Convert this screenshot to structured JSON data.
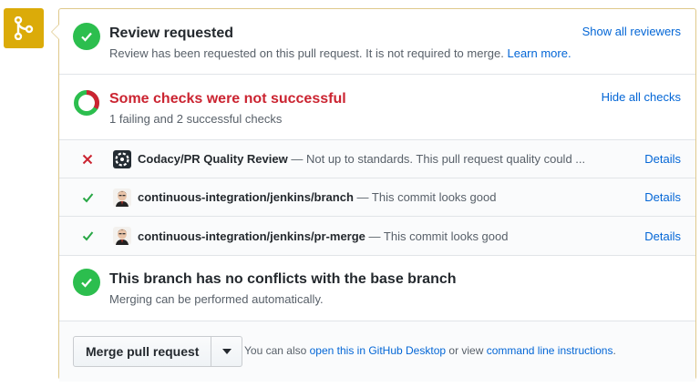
{
  "review": {
    "title": "Review requested",
    "subtitle": "Review has been requested on this pull request. It is not required to merge.",
    "learn_more": "Learn more.",
    "show_reviewers": "Show all reviewers"
  },
  "checks": {
    "title": "Some checks were not successful",
    "subtitle": "1 failing and 2 successful checks",
    "hide_all": "Hide all checks",
    "summary": {
      "failing": 1,
      "successful": 2
    },
    "items": [
      {
        "status": "failure",
        "context": "Codacy/PR Quality Review",
        "description": "— Not up to standards. This pull request quality could ...",
        "details": "Details",
        "avatar_icon": "codacy-logo-icon"
      },
      {
        "status": "success",
        "context": "continuous-integration/jenkins/branch",
        "description": "— This commit looks good",
        "details": "Details",
        "avatar_icon": "jenkins-avatar-icon"
      },
      {
        "status": "success",
        "context": "continuous-integration/jenkins/pr-merge",
        "description": "— This commit looks good",
        "details": "Details",
        "avatar_icon": "jenkins-avatar-icon"
      }
    ]
  },
  "branch": {
    "title": "This branch has no conflicts with the base branch",
    "subtitle": "Merging can be performed automatically."
  },
  "merge": {
    "button_label": "Merge pull request",
    "note_prefix": "You can also",
    "desktop_link": "open this in GitHub Desktop",
    "note_middle": "or view",
    "cli_link": "command line instructions",
    "note_suffix": "."
  },
  "colors": {
    "success": "#2cbe4e",
    "failure": "#cb2431",
    "link": "#0366d6",
    "badge": "#dbab09",
    "border": "#dfc98b"
  }
}
